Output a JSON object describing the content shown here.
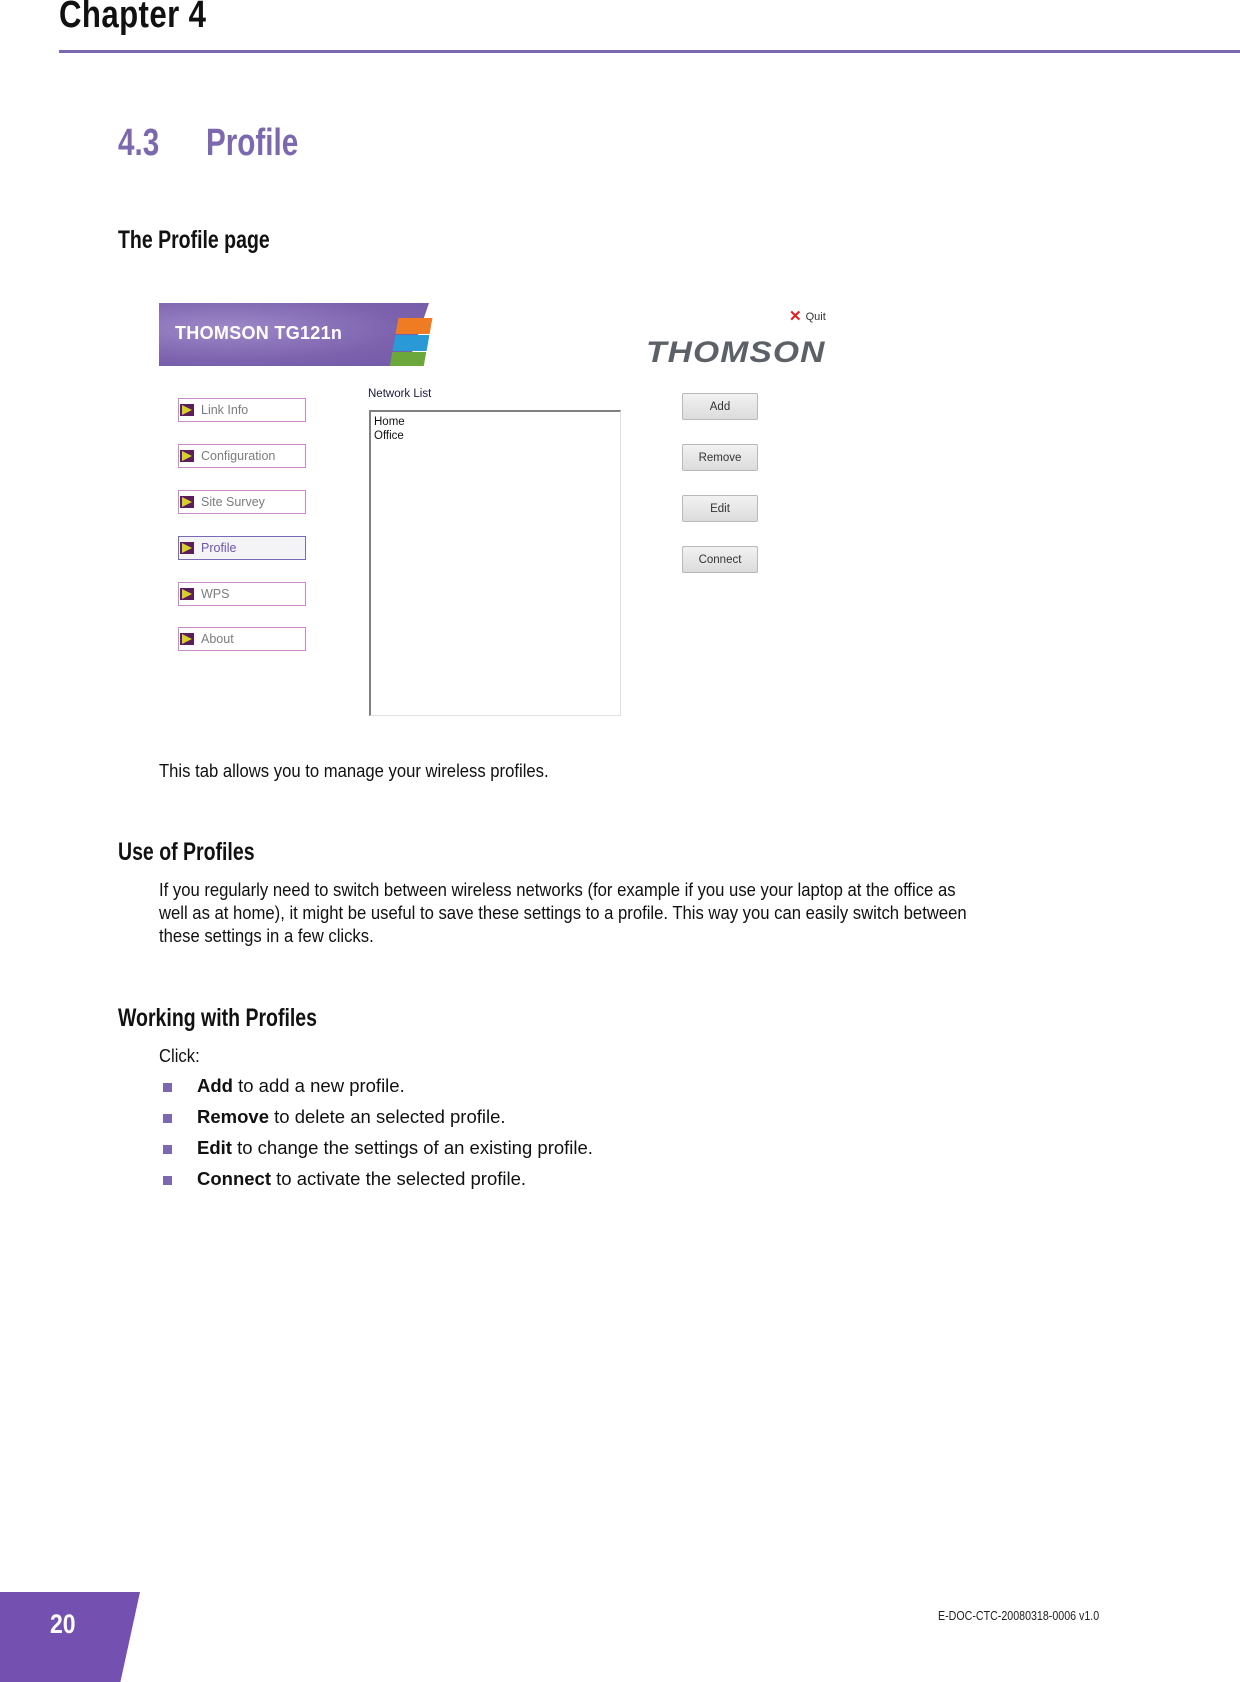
{
  "chapter": {
    "title": "Chapter 4"
  },
  "section": {
    "number": "4.3",
    "title": "Profile"
  },
  "subsections": {
    "profile_page": "The Profile page",
    "use_of_profiles": "Use of Profiles",
    "working_with_profiles": "Working with Profiles"
  },
  "app": {
    "banner_title": "THOMSON TG121n",
    "quit_label": "Quit",
    "logo_text": "THOMSON",
    "nav": [
      {
        "label": "Link Info",
        "active": false
      },
      {
        "label": "Configuration",
        "active": false
      },
      {
        "label": "Site Survey",
        "active": false
      },
      {
        "label": "Profile",
        "active": true
      },
      {
        "label": "WPS",
        "active": false
      },
      {
        "label": "About",
        "active": false
      }
    ],
    "network_list_label": "Network List",
    "network_list": [
      "Home",
      "Office"
    ],
    "buttons": {
      "add": "Add",
      "remove": "Remove",
      "edit": "Edit",
      "connect": "Connect"
    },
    "colors": {
      "accent": "#7c68ae",
      "quit": "#e02020",
      "stripe_orange": "#ef7b22",
      "stripe_blue": "#2a9ad7",
      "stripe_green": "#6ca73b"
    }
  },
  "text": {
    "tab_description": "This tab allows you to manage your wireless profiles.",
    "use_paragraph_lines": [
      "If you regularly need to switch between wireless networks (for example if you use your laptop at the office as",
      "well as at home), it might be useful to save these settings to a profile. This way you can easily switch between",
      "these settings in a few clicks."
    ],
    "click_label": "Click:",
    "bullets": [
      {
        "bold": "Add",
        "rest": " to add a new profile."
      },
      {
        "bold": "Remove",
        "rest": " to delete an selected profile."
      },
      {
        "bold": "Edit",
        "rest": " to change the settings of an existing profile."
      },
      {
        "bold": "Connect",
        "rest": " to activate the selected profile."
      }
    ]
  },
  "footer": {
    "page_number": "20",
    "doc_id": "E-DOC-CTC-20080318-0006 v1.0"
  }
}
